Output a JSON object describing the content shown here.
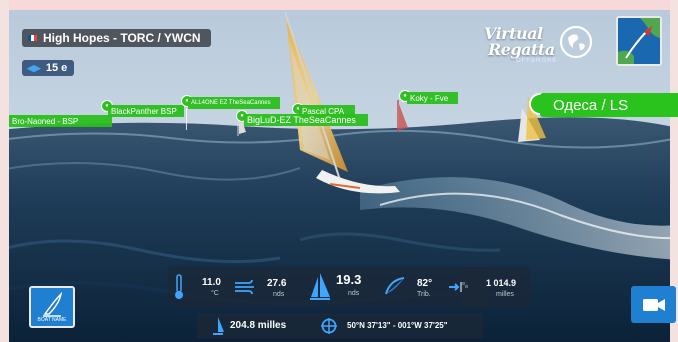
{
  "header": {
    "title": "High Hopes - TORC / YWCN",
    "flag_colors": [
      "#0055a4",
      "#ffffff",
      "#ef4135"
    ],
    "rank_label": "15 e",
    "rank_icon": "rank-icon"
  },
  "logo": {
    "line1": "Virtual",
    "line2": "Regatta",
    "line3": "OFFSHORE",
    "icon": "globe-icon"
  },
  "map_button": {
    "icon": "map-icon"
  },
  "boat_tags": {
    "tag1": "Bro-Naoned - BSP",
    "tag2": "BlackPanther BSP",
    "tag3": "ALL4ONE EZ TheSeaCannes",
    "tag4": "BigLuD-EZ TheSeaCannes",
    "tag5": "Pascal CPA",
    "tag6": "Koky - Fve",
    "tag_big": "Одеса / LS"
  },
  "controls": {
    "boat_name_label": "BOAT NAME",
    "boat_name_icon": "sail-icon",
    "camera_icon": "camera-icon"
  },
  "instruments": {
    "temperature": {
      "value": "11.0",
      "unit": "°C",
      "icon": "thermometer-icon"
    },
    "wind_speed": {
      "value": "27.6",
      "unit": "nds",
      "icon": "wind-icon"
    },
    "boat_speed": {
      "value": "19.3",
      "unit": "nds",
      "icon": "sailboat-icon"
    },
    "wind_angle": {
      "value": "82°",
      "unit": "Trib.",
      "icon": "sail-angle-icon"
    },
    "distance_to_finish": {
      "value": "1 014.9",
      "unit": "milles",
      "icon": "finish-flag-icon"
    },
    "distance_sailed": {
      "value": "204.8 milles",
      "icon": "boat-icon"
    },
    "position": {
      "value": "50°N 37'13\" - 001°W 37'25\"",
      "icon": "crosshair-icon"
    }
  },
  "colors": {
    "tag_green": "#2ac21c",
    "button_blue": "#1f7fd1",
    "sea_dark": "#0d2942",
    "sky": "#c9d9e8"
  }
}
